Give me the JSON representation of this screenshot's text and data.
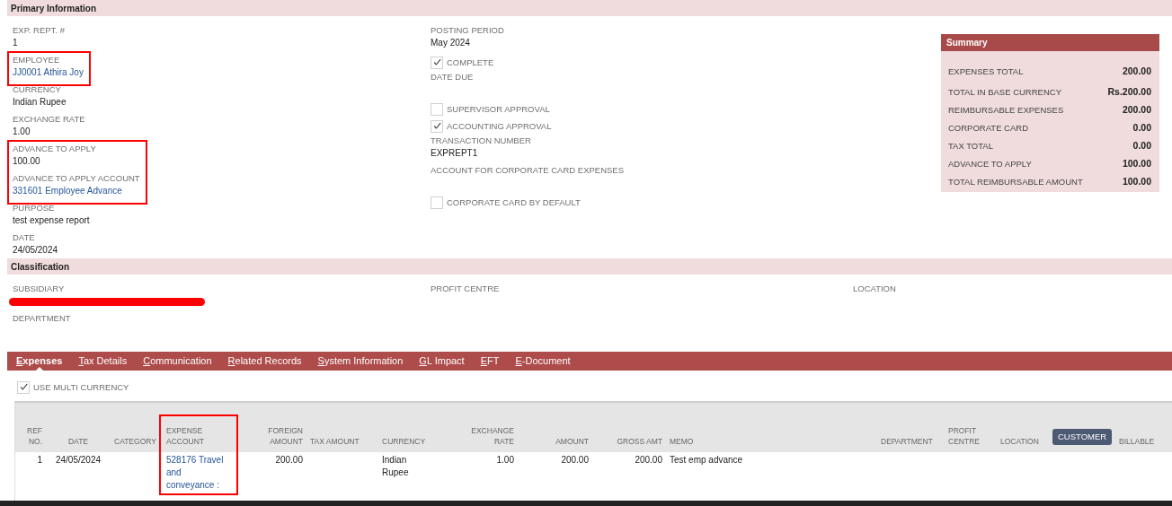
{
  "primary": {
    "title": "Primary Information",
    "left_groups": [
      {
        "highlighted": false,
        "fields": [
          {
            "label": "EXP. REPT. #",
            "value": "1",
            "link": false
          }
        ]
      },
      {
        "highlighted": true,
        "fields": [
          {
            "label": "EMPLOYEE",
            "value": "JJ0001 Athira Joy",
            "link": true
          }
        ]
      },
      {
        "highlighted": false,
        "fields": [
          {
            "label": "CURRENCY",
            "value": "Indian Rupee",
            "link": false
          },
          {
            "label": "EXCHANGE RATE",
            "value": "1.00",
            "link": false
          }
        ]
      },
      {
        "highlighted": true,
        "fields": [
          {
            "label": "ADVANCE TO APPLY",
            "value": "100.00",
            "link": false
          },
          {
            "label": "ADVANCE TO APPLY ACCOUNT",
            "value": "331601 Employee Advance",
            "link": true
          }
        ]
      },
      {
        "highlighted": false,
        "fields": [
          {
            "label": "PURPOSE",
            "value": "test expense report",
            "link": false
          },
          {
            "label": "DATE",
            "value": "24/05/2024",
            "link": false
          }
        ]
      }
    ],
    "middle_items": [
      {
        "kind": "field",
        "label": "POSTING PERIOD",
        "value": "May 2024"
      },
      {
        "kind": "checkbox",
        "label": "COMPLETE",
        "checked": true
      },
      {
        "kind": "field",
        "label": "DATE DUE"
      },
      {
        "kind": "checkbox",
        "label": "SUPERVISOR APPROVAL",
        "checked": false
      },
      {
        "kind": "checkbox",
        "label": "ACCOUNTING APPROVAL",
        "checked": true
      },
      {
        "kind": "field",
        "label": "TRANSACTION NUMBER",
        "value": "EXPREPT1"
      },
      {
        "kind": "field",
        "label": "ACCOUNT FOR CORPORATE CARD EXPENSES"
      },
      {
        "kind": "checkbox",
        "label": "CORPORATE CARD BY DEFAULT",
        "checked": false
      }
    ],
    "summary": {
      "title": "Summary",
      "rows": [
        {
          "label": "EXPENSES TOTAL",
          "value": "200.00"
        },
        {
          "label": "TOTAL IN BASE CURRENCY",
          "value": "Rs.200.00"
        },
        {
          "label": "REIMBURSABLE EXPENSES",
          "value": "200.00"
        },
        {
          "label": "CORPORATE CARD",
          "value": "0.00"
        },
        {
          "label": "TAX TOTAL",
          "value": "0.00"
        },
        {
          "label": "ADVANCE TO APPLY",
          "value": "100.00"
        },
        {
          "label": "TOTAL REIMBURSABLE AMOUNT",
          "value": "100.00"
        }
      ]
    }
  },
  "classification": {
    "title": "Classification",
    "columns": [
      [
        {
          "label": "SUBSIDIARY",
          "redacted": true
        },
        {
          "label": "DEPARTMENT",
          "redacted": false
        }
      ],
      [
        {
          "label": "PROFIT CENTRE",
          "redacted": false
        }
      ],
      [
        {
          "label": "LOCATION",
          "redacted": false
        }
      ]
    ]
  },
  "tabs": [
    {
      "label": "Expenses",
      "selected": true
    },
    {
      "label": "Tax Details",
      "selected": false
    },
    {
      "label": "Communication",
      "selected": false
    },
    {
      "label": "Related Records",
      "selected": false
    },
    {
      "label": "System Information",
      "selected": false
    },
    {
      "label": "GL Impact",
      "selected": false
    },
    {
      "label": "EFT",
      "selected": false
    },
    {
      "label": "E-Document",
      "selected": false
    }
  ],
  "multi_currency": {
    "label": "USE MULTI CURRENCY",
    "checked": true
  },
  "table": {
    "columns": [
      {
        "label": "REF NO.",
        "highlighted": false
      },
      {
        "label": "DATE",
        "highlighted": false
      },
      {
        "label": "CATEGORY",
        "highlighted": false
      },
      {
        "label": "EXPENSE ACCOUNT",
        "highlighted": true
      },
      {
        "label": "FOREIGN AMOUNT",
        "highlighted": false
      },
      {
        "label": "TAX AMOUNT",
        "highlighted": false
      },
      {
        "label": "CURRENCY",
        "highlighted": false
      },
      {
        "label": "EXCHANGE RATE",
        "highlighted": false
      },
      {
        "label": "AMOUNT",
        "highlighted": false
      },
      {
        "label": "GROSS AMT",
        "highlighted": false
      },
      {
        "label": "MEMO",
        "highlighted": false
      },
      {
        "label": "DEPARTMENT",
        "highlighted": false
      },
      {
        "label": "PROFIT CENTRE",
        "highlighted": false
      },
      {
        "label": "LOCATION",
        "highlighted": false
      },
      {
        "tooltip": "CUSTOMER",
        "highlighted": false
      },
      {
        "label": "BILLABLE",
        "highlighted": false
      }
    ],
    "rows": [
      {
        "cells": [
          "1",
          "24/05/2024",
          null,
          "528176 Travel and conveyance :",
          "200.00",
          null,
          "Indian Rupee",
          "1.00",
          "200.00",
          "200.00",
          "Test emp advance",
          null,
          null,
          null,
          null,
          null
        ]
      }
    ]
  }
}
